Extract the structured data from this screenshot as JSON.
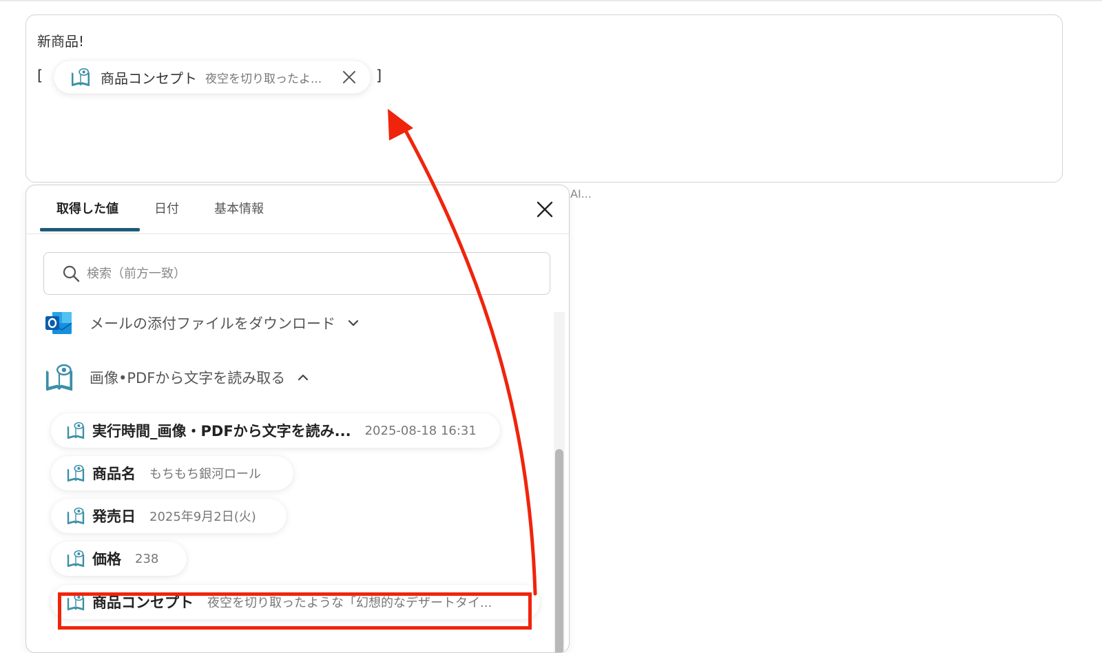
{
  "editor": {
    "line1": "新商品!",
    "bracket_open": "[",
    "bracket_close": "]",
    "chip": {
      "name": "商品コンセプト",
      "value": "夜空を切り取ったよ..."
    }
  },
  "ai_truncated": "AI...",
  "panel": {
    "tabs": [
      {
        "label": "取得した値",
        "active": true
      },
      {
        "label": "日付",
        "active": false
      },
      {
        "label": "基本情報",
        "active": false
      }
    ],
    "search_placeholder": "検索（前方一致）",
    "groups": [
      {
        "label": "メールの添付ファイルをダウンロード",
        "icon": "outlook-icon",
        "expanded": false
      },
      {
        "label": "画像•PDFから文字を読み取る",
        "icon": "book-eye-icon",
        "expanded": true
      }
    ],
    "items": [
      {
        "name": "実行時間_画像・PDFから文字を読み...",
        "value": "2025-08-18 16:31"
      },
      {
        "name": "商品名",
        "value": "もちもち銀河ロール"
      },
      {
        "name": "発売日",
        "value": "2025年9月2日(火)"
      },
      {
        "name": "価格",
        "value": "238"
      },
      {
        "name": "商品コンセプト",
        "value": "夜空を切り取ったような「幻想的なデザートタイ..."
      }
    ]
  },
  "colors": {
    "accent": "#1f5a78",
    "annotation_red": "#f0240c",
    "icon_teal": "#3a8fa6"
  }
}
